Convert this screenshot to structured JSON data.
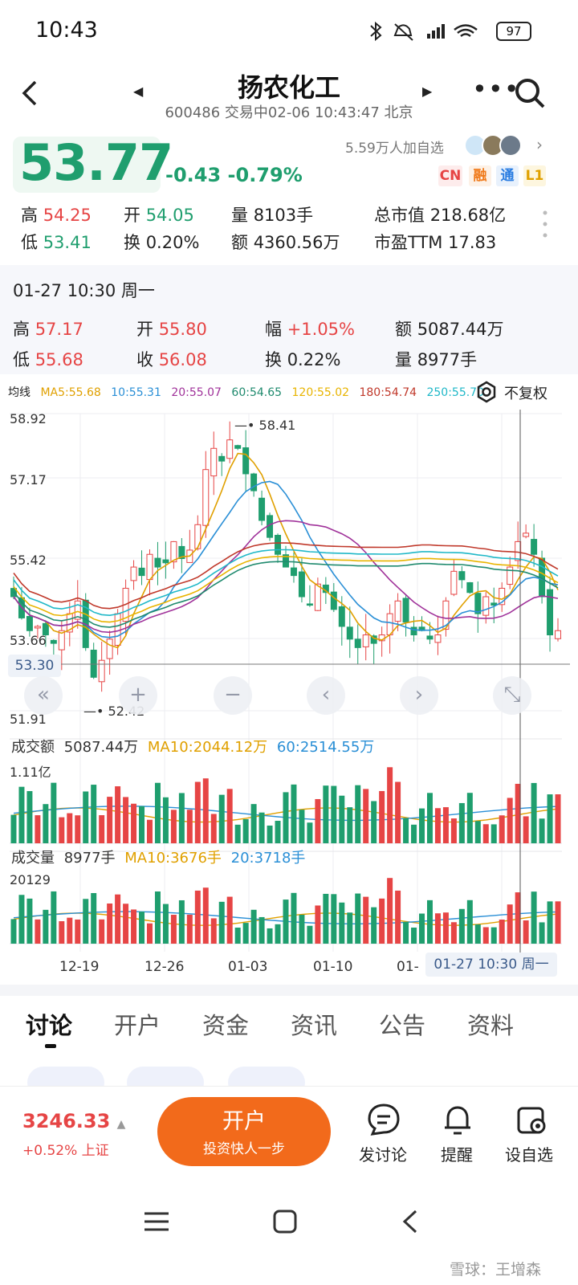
{
  "status_bar": {
    "time": "10:43",
    "battery": "97"
  },
  "header": {
    "title": "扬农化工",
    "subtitle": "600486 交易中02-06 10:43:47 北京",
    "back_icon": "back-arrow-icon",
    "more_icon": "more-icon",
    "search_icon": "search-icon"
  },
  "quote": {
    "price": "53.77",
    "change": "-0.43 -0.79%",
    "watchers": "5.59万人加自选",
    "badges": [
      {
        "text": "CN",
        "color": "#e64545",
        "bg": "#fdecec"
      },
      {
        "text": "融",
        "color": "#f07a1a",
        "bg": "#fdf1e6"
      },
      {
        "text": "通",
        "color": "#2a7de1",
        "bg": "#e8f1fc"
      },
      {
        "text": "L1",
        "color": "#e0a000",
        "bg": "#fdf6df"
      }
    ],
    "stats": {
      "high_label": "高",
      "high": "54.25",
      "open_label": "开",
      "open": "54.05",
      "vol_label": "量",
      "vol": "8103手",
      "mcap_label": "总市值",
      "mcap": "218.68亿",
      "low_label": "低",
      "low": "53.41",
      "turn_label": "换",
      "turn": "0.20%",
      "amt_label": "额",
      "amt": "4360.56万",
      "pe_label": "市盈TTM",
      "pe": "17.83"
    }
  },
  "candle_info": {
    "datetime": "01-27 10:30 周一",
    "high_label": "高",
    "high": "57.17",
    "open_label": "开",
    "open": "55.80",
    "amp_label": "幅",
    "amp": "+1.05%",
    "amt_label": "额",
    "amt": "5087.44万",
    "low_label": "低",
    "low": "55.68",
    "close_label": "收",
    "close": "56.08",
    "turn_label": "换",
    "turn": "0.22%",
    "vol_label": "量",
    "vol": "8977手"
  },
  "ma": {
    "label": "均线",
    "items": [
      {
        "text": "MA5:55.68",
        "color": "#e0a000"
      },
      {
        "text": "10:55.31",
        "color": "#2a8fd6"
      },
      {
        "text": "20:55.07",
        "color": "#a0329a"
      },
      {
        "text": "60:54.65",
        "color": "#1f8a6e"
      },
      {
        "text": "120:55.02",
        "color": "#e8b400"
      },
      {
        "text": "180:54.74",
        "color": "#c0392b"
      },
      {
        "text": "250:55.70",
        "color": "#20b8c8"
      }
    ],
    "adjust_label": "不复权",
    "adjust_icon": "settings-icon"
  },
  "chart_data": {
    "type": "candlestick",
    "y_ticks": [
      "58.92",
      "57.17",
      "55.42",
      "53.66",
      "51.91"
    ],
    "ylim": [
      51.91,
      58.92
    ],
    "high_marker": "58.41",
    "low_marker": "52.42",
    "current_price": "53.30",
    "x_ticks": [
      "12-19",
      "12-26",
      "01-03",
      "01-10",
      "01-"
    ],
    "crosshair_date": "01-27 10:30 周一",
    "closes": [
      54.6,
      54.1,
      53.8,
      53.9,
      53.7,
      53.5,
      53.8,
      54.2,
      54.5,
      53.4,
      52.7,
      53.1,
      53.6,
      54.2,
      54.8,
      55.3,
      55.1,
      55.6,
      55.3,
      55.4,
      55.9,
      55.5,
      55.7,
      56.3,
      57.6,
      58.1,
      57.8,
      58.3,
      58.1,
      57.5,
      57.1,
      56.4,
      56.0,
      55.6,
      55.3,
      55.1,
      54.6,
      54.4,
      54.9,
      54.7,
      54.3,
      53.9,
      53.6,
      53.4,
      53.7,
      53.5,
      53.7,
      54.2,
      54.5,
      54.0,
      53.7,
      53.8,
      53.6,
      53.7,
      54.5,
      55.2,
      55.0,
      54.7,
      54.2,
      54.6,
      54.4,
      54.8,
      55.3,
      55.9,
      56.1,
      55.6,
      54.6,
      53.7,
      53.8
    ],
    "series": [
      {
        "name": "MA5",
        "color": "#e0a000"
      },
      {
        "name": "MA10",
        "color": "#2a8fd6"
      },
      {
        "name": "MA20",
        "color": "#a0329a"
      },
      {
        "name": "MA60",
        "color": "#1f8a6e"
      },
      {
        "name": "MA120",
        "color": "#e8b400"
      },
      {
        "name": "MA180",
        "color": "#c0392b"
      },
      {
        "name": "MA250",
        "color": "#20b8c8"
      }
    ],
    "amount_panel": {
      "label": "成交额",
      "value": "5087.44万",
      "ma10": "MA10:2044.12万",
      "ma60": "60:2514.55万",
      "top": "1.11亿"
    },
    "volume_panel": {
      "label": "成交量",
      "value": "8977手",
      "ma10": "MA10:3676手",
      "ma20": "20:3718手",
      "top": "20129"
    }
  },
  "tabs": [
    "讨论",
    "开户",
    "资金",
    "资讯",
    "公告",
    "资料"
  ],
  "bottom_bar": {
    "index_value": "3246.33",
    "index_change": "+0.52% 上证",
    "open_title": "开户",
    "open_sub": "投资快人一步",
    "discuss": "发讨论",
    "remind": "提醒",
    "watchlist": "设自选"
  },
  "watermark": "雪球：王增森"
}
